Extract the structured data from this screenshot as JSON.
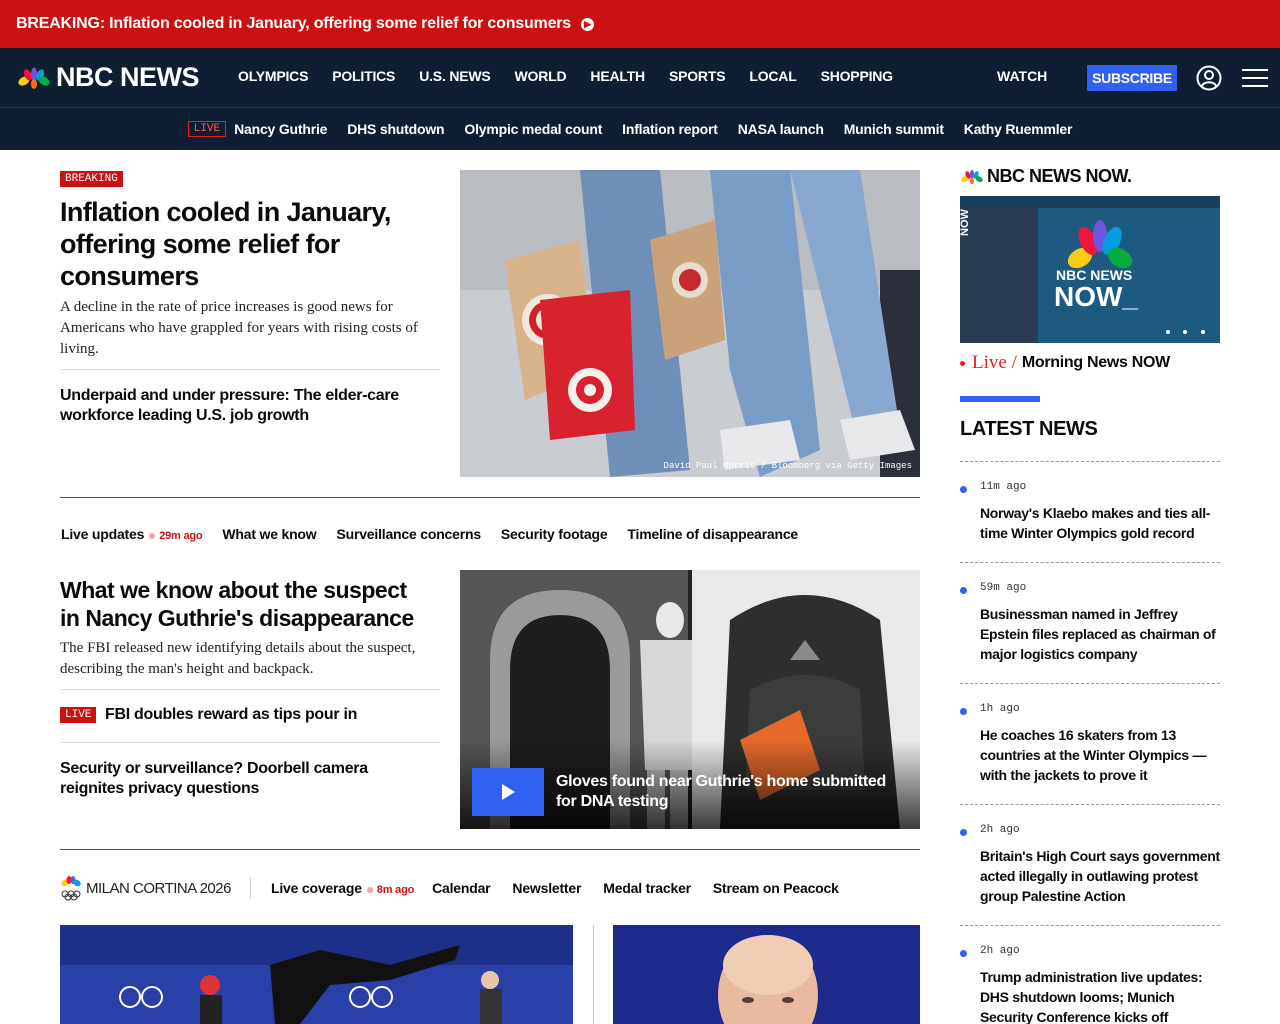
{
  "breaking_banner": {
    "label": "BREAKING:",
    "text": "Inflation cooled in January, offering some relief for consumers"
  },
  "header": {
    "logo_text": "NBC NEWS",
    "nav": [
      "OLYMPICS",
      "POLITICS",
      "U.S. NEWS",
      "WORLD",
      "HEALTH",
      "SPORTS",
      "LOCAL",
      "SHOPPING"
    ],
    "watch": "WATCH",
    "subscribe": "SUBSCRIBE",
    "subnav_live_tag": "LIVE",
    "subnav": [
      "Nancy Guthrie",
      "DHS shutdown",
      "Olympic medal count",
      "Inflation report",
      "NASA launch",
      "Munich summit",
      "Kathy Ruemmler"
    ]
  },
  "lead": {
    "tag": "BREAKING",
    "headline": "Inflation cooled in January, offering some relief for consumers",
    "dek": "A decline in the rate of price increases is good news for Americans who have grappled for years with rising costs of living.",
    "related": "Underpaid and under pressure: The elder-care workforce leading U.S. job growth",
    "image_credit": "David Paul Morris / Bloomberg via Getty Images"
  },
  "story_nav": {
    "live_label": "Live updates",
    "live_time": "29m ago",
    "items": [
      "What we know",
      "Surveillance concerns",
      "Security footage",
      "Timeline of disappearance"
    ]
  },
  "story2": {
    "headline": "What we know about the suspect in Nancy Guthrie's disappearance",
    "dek": "The FBI released new identifying details about the suspect, describing the man's height and backpack.",
    "live_tag": "LIVE",
    "live_related": "FBI doubles reward as tips pour in",
    "related": "Security or surveillance? Doorbell camera reignites privacy questions",
    "video_caption": "Gloves found near Guthrie's home submitted for DNA testing"
  },
  "olympics": {
    "logo_text": "MILAN CORTINA 2026",
    "live_label": "Live coverage",
    "live_time": "8m ago",
    "items": [
      "Calendar",
      "Newsletter",
      "Medal tracker",
      "Stream on Peacock"
    ]
  },
  "rail": {
    "nnn_logo": "NBC NEWS NOW.",
    "nnn_img_text": "NBC NEWS NOW.",
    "nnn_side_label": "NOW",
    "live_label": "Live /",
    "live_title": "Morning News NOW",
    "latest_title": "LATEST NEWS",
    "latest": [
      {
        "time": "11m ago",
        "headline": "Norway's Klaebo makes and ties all-time Winter Olympics gold record"
      },
      {
        "time": "59m ago",
        "headline": "Businessman named in Jeffrey Epstein files replaced as chairman of major logistics company"
      },
      {
        "time": "1h ago",
        "headline": "He coaches 16 skaters from 13 countries at the Winter Olympics — with the jackets to prove it"
      },
      {
        "time": "2h ago",
        "headline": "Britain's High Court says government acted illegally in outlawing protest group Palestine Action"
      },
      {
        "time": "2h ago",
        "headline": "Trump administration live updates: DHS shutdown looms; Munich Security Conference kicks off"
      }
    ]
  },
  "colors": {
    "breaking_red": "#cb1111",
    "header_navy": "#0f1e33",
    "accent_blue": "#3061f2"
  }
}
